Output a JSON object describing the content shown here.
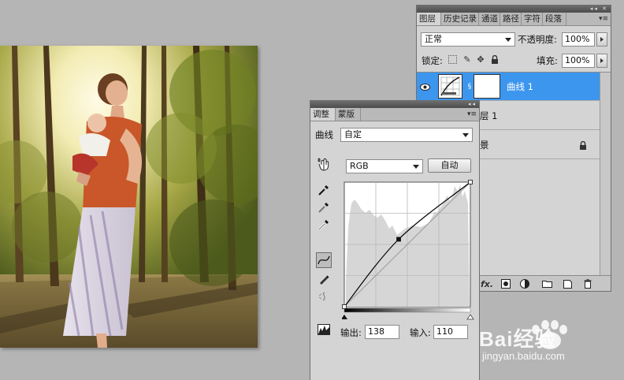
{
  "layers_panel": {
    "tabs": [
      "图层",
      "历史记录",
      "通道",
      "路径",
      "字符",
      "段落"
    ],
    "blend_mode": "正常",
    "opacity_label": "不透明度:",
    "opacity_value": "100%",
    "lock_label": "锁定:",
    "fill_label": "填充:",
    "fill_value": "100%",
    "layers": [
      {
        "name": "曲线 1"
      },
      {
        "name": "层 1"
      },
      {
        "name": "景"
      }
    ],
    "footer_icons": [
      "fx-icon",
      "mask-icon",
      "adjustment-icon",
      "group-icon",
      "new-layer-icon",
      "trash-icon"
    ]
  },
  "adjust_panel": {
    "tabs": [
      "调整",
      "蒙版"
    ],
    "curve_label": "曲线",
    "preset_value": "自定",
    "channel_value": "RGB",
    "auto_button": "自动",
    "output_label": "输出:",
    "output_value": "138",
    "input_label": "输入:",
    "input_value": "110"
  },
  "curve": {
    "points": [
      [
        0,
        0
      ],
      [
        110,
        138
      ],
      [
        255,
        255
      ]
    ]
  },
  "watermark": {
    "text": "Bai经验",
    "url": "jingyan.baidu.com"
  },
  "colors": {
    "selection": "#3d96ee",
    "panel_bg": "#d4d4d4",
    "app_bg": "#b5b5b5"
  }
}
